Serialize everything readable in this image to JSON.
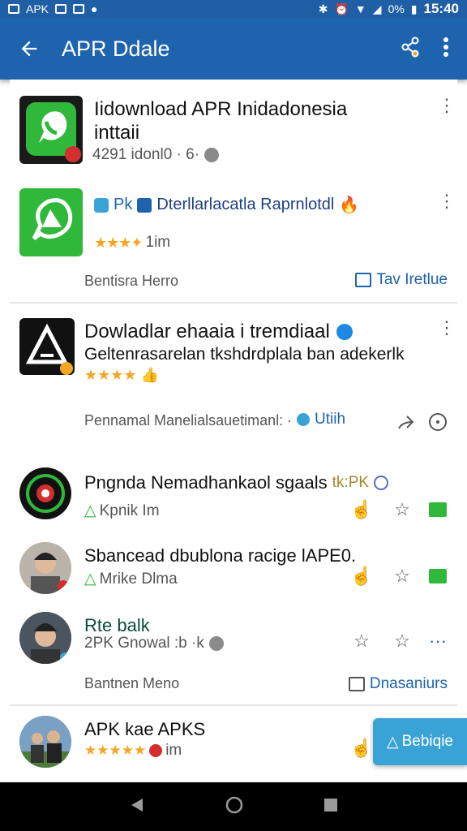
{
  "status_bar": {
    "left_label": "APK",
    "battery": "0%",
    "time": "15:40"
  },
  "app_bar": {
    "title": "APR Ddale"
  },
  "cards": {
    "first": {
      "title_line1": "Iidownload APR Inidadonesia",
      "title_line2": "inttaii",
      "meta": "4291 idonl0 · 6·",
      "promo_badge": "Pk",
      "promo_title": "Dterllarlacatla Raprnlotdl",
      "promo_rating": "1im",
      "footer_left": "Bentisra Herro",
      "footer_link": "Tav Iretlue"
    },
    "second": {
      "title": "Dowladlar ehaaia i tremdiaal",
      "subtitle": "Geltenrasarelan tkshdrdplala ban adekerlk",
      "footer_left": "Pennamal Manelialsauetimanl: ·",
      "footer_link": "Utiih"
    },
    "list": [
      {
        "title": "Pngnda Nemadhankaol sgaals",
        "title_suffix": "tk:PK",
        "sub": "Kpnik   Im"
      },
      {
        "title": "Sbancead dbublona racige lAPE0.",
        "sub": "Mrike Dlma"
      },
      {
        "title": "Rte balk",
        "sub": "2PK Gnowal :b ·k"
      }
    ],
    "list_footer": {
      "left": "Bantnen Meno",
      "link": "Dnasaniurs"
    },
    "last": {
      "title": "APK kae APKS",
      "rating_text": "im"
    }
  },
  "fab": {
    "label": "Bebiqie"
  },
  "colors": {
    "primary": "#1e63ad",
    "accent": "#39a3d6",
    "whatsapp_green": "#2fb83a",
    "star": "#f5a623"
  }
}
